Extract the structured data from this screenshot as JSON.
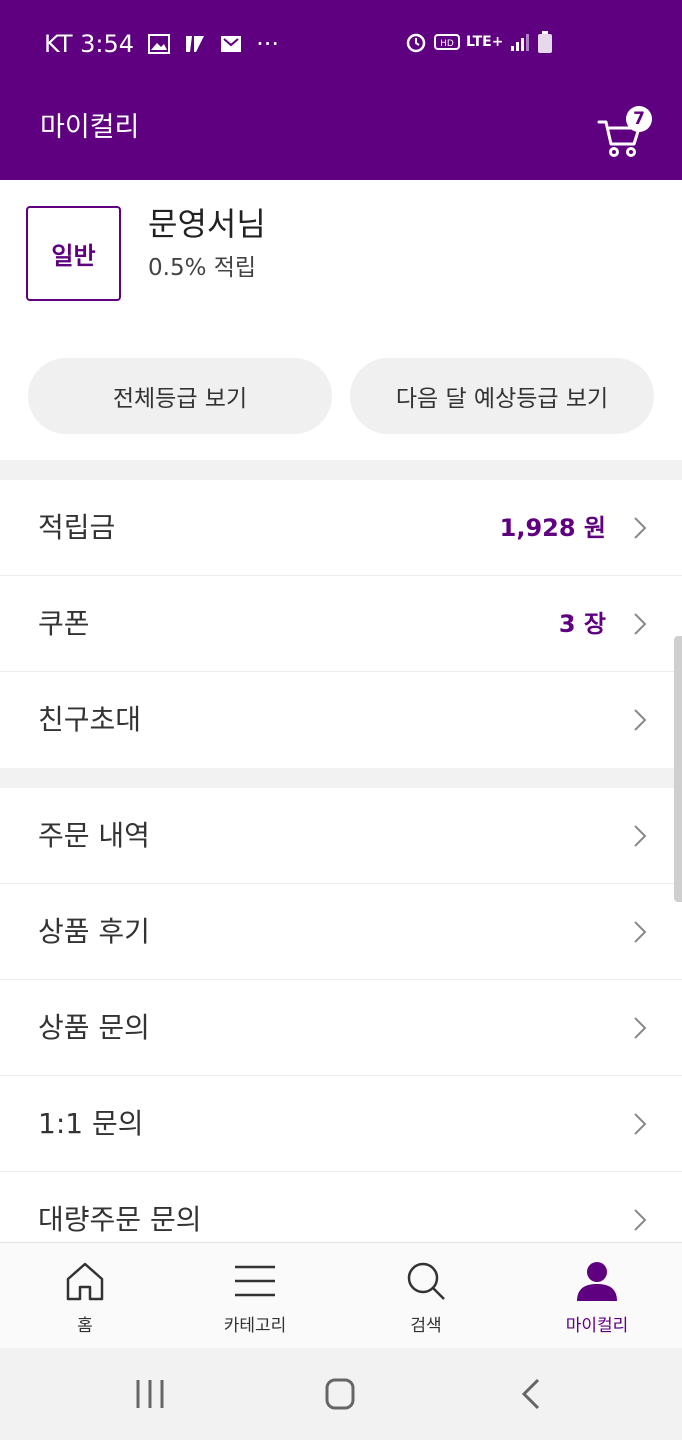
{
  "status_bar": {
    "carrier_time": "KT 3:54",
    "more": "···",
    "network": "LTE+"
  },
  "app_bar": {
    "title": "마이컬리",
    "cart_count": "7"
  },
  "profile": {
    "grade": "일반",
    "name": "문영서님",
    "rate": "0.5% 적립",
    "btn_all_grades": "전체등급 보기",
    "btn_next_grade": "다음 달 예상등급 보기"
  },
  "menu_group1": [
    {
      "label": "적립금",
      "value": "1,928 원"
    },
    {
      "label": "쿠폰",
      "value": "3 장"
    },
    {
      "label": "친구초대",
      "value": ""
    }
  ],
  "menu_group2": [
    {
      "label": "주문 내역"
    },
    {
      "label": "상품 후기"
    },
    {
      "label": "상품 문의"
    },
    {
      "label": "1:1 문의"
    },
    {
      "label": "대량주문 문의"
    }
  ],
  "tabs": [
    {
      "label": "홈",
      "icon": "home-icon"
    },
    {
      "label": "카테고리",
      "icon": "menu-icon"
    },
    {
      "label": "검색",
      "icon": "search-icon"
    },
    {
      "label": "마이컬리",
      "icon": "person-icon",
      "active": true
    }
  ],
  "colors": {
    "brand": "#5f0080"
  }
}
